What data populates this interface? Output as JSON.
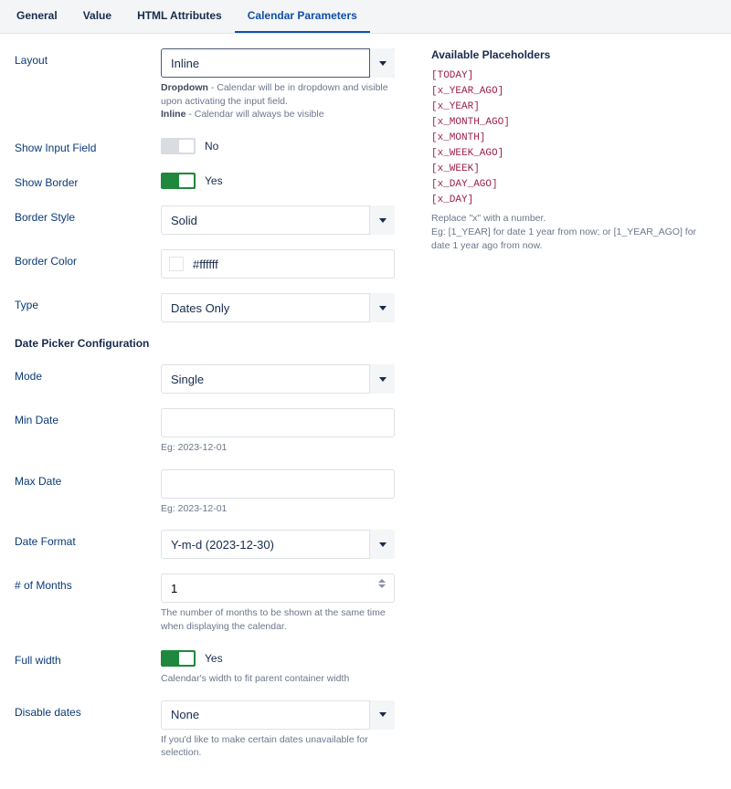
{
  "tabs": {
    "general": "General",
    "value": "Value",
    "html": "HTML Attributes",
    "cal": "Calendar Parameters"
  },
  "labels": {
    "layout": "Layout",
    "show_input": "Show Input Field",
    "show_border": "Show Border",
    "border_style": "Border Style",
    "border_color": "Border Color",
    "type": "Type",
    "section_dp": "Date Picker Configuration",
    "mode": "Mode",
    "min_date": "Min Date",
    "max_date": "Max Date",
    "date_format": "Date Format",
    "num_months": "# of Months",
    "full_width": "Full width",
    "disable_dates": "Disable dates"
  },
  "values": {
    "layout": "Inline",
    "border_style": "Solid",
    "border_color": "#ffffff",
    "type": "Dates Only",
    "mode": "Single",
    "min_date": "",
    "max_date": "",
    "date_format": "Y-m-d (2023-12-30)",
    "num_months": "1",
    "disable_dates": "None"
  },
  "toggles": {
    "show_input": {
      "on": false,
      "label": "No"
    },
    "show_border": {
      "on": true,
      "label": "Yes"
    },
    "full_width": {
      "on": true,
      "label": "Yes"
    }
  },
  "help": {
    "layout_dd_b": "Dropdown",
    "layout_dd_t": " - Calendar will be in dropdown and visible upon activating the input field.",
    "layout_in_b": "Inline",
    "layout_in_t": " - Calendar will always be visible",
    "min_date_eg": "Eg: 2023-12-01",
    "max_date_eg": "Eg: 2023-12-01",
    "num_months": "The number of months to be shown at the same time when displaying the calendar.",
    "full_width": "Calendar's width to fit parent container width",
    "disable_dates": "If you'd like to make certain dates unavailable for selection."
  },
  "side": {
    "title": "Available Placeholders",
    "items": [
      "[TODAY]",
      "[x_YEAR_AGO]",
      "[x_YEAR]",
      "[x_MONTH_AGO]",
      "[x_MONTH]",
      "[x_WEEK_AGO]",
      "[x_WEEK]",
      "[x_DAY_AGO]",
      "[x_DAY]"
    ],
    "help1": "Replace \"x\" with a number.",
    "help2": "Eg: [1_YEAR] for date 1 year from now; or [1_YEAR_AGO] for date 1 year ago from now."
  }
}
